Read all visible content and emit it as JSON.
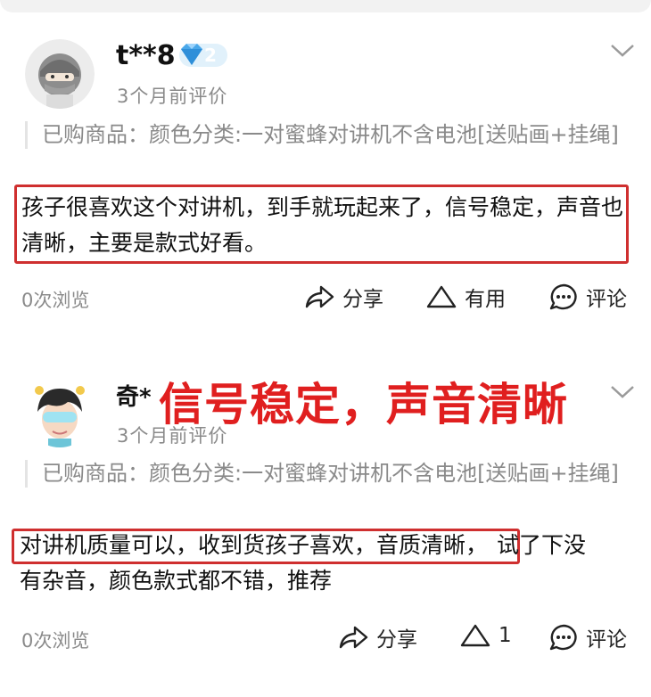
{
  "reviews": [
    {
      "username": "t**8",
      "level": "2",
      "time": "3个月前评价",
      "purchased": "已购商品：颜色分类:一对蜜蜂对讲机不含电池[送贴画+挂绳]",
      "text": "孩子很喜欢这个对讲机，到手就玩起来了，信号稳定，声音也清晰，主要是款式好看。",
      "views": "0次浏览",
      "share_label": "分享",
      "useful_label": "有用",
      "comment_label": "评论"
    },
    {
      "username": "奇*",
      "time": "3个月前评价",
      "purchased": "已购商品：颜色分类:一对蜜蜂对讲机不含电池[送贴画+挂绳]",
      "text_highlight": "对讲机质量可以，收到货孩子喜欢，音质清晰，",
      "text_rest_1": "试了下没",
      "text_rest_2": "有杂音，颜色款式都不错，推荐",
      "views": "0次浏览",
      "share_label": "分享",
      "useful_label": "1",
      "comment_label": "评论"
    }
  ],
  "overlay_caption": "信号稳定，声音清晰",
  "colors": {
    "highlight": "#cf2f2f",
    "caption": "#e01f1f",
    "muted": "#8a8a8a"
  }
}
